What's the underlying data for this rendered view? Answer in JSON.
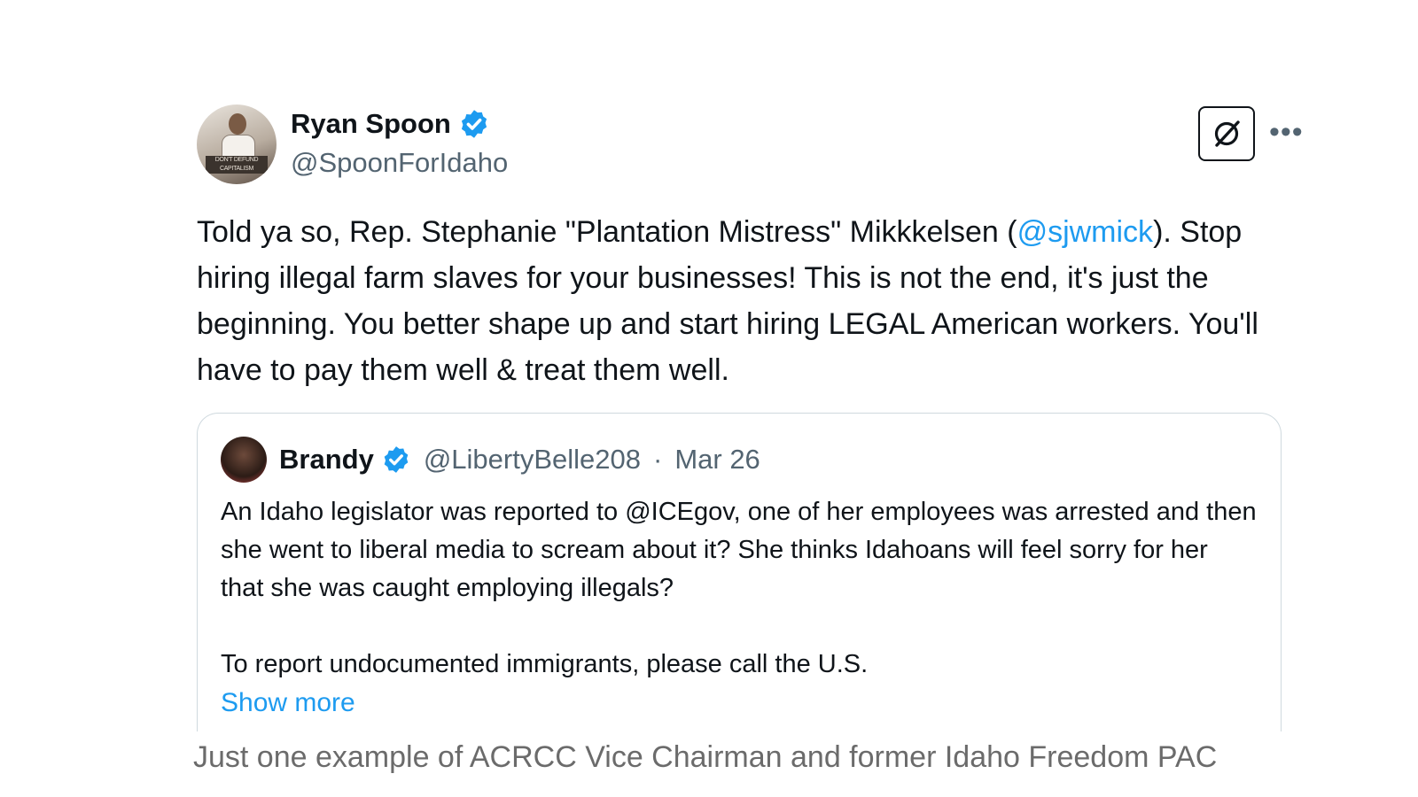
{
  "tweet": {
    "author_name": "Ryan Spoon",
    "author_handle": "@SpoonForIdaho",
    "avatar_caption": "DON'T DEFUND CAPITALISM",
    "more_label": "•••",
    "text_before": "Told ya so, Rep. Stephanie \"Plantation Mistress\" Mikkkelsen (",
    "mention": "@sjwmick",
    "text_after": "). Stop hiring illegal farm slaves for your businesses! This is not the end, it's just the beginning. You better shape up and start hiring LEGAL American workers. You'll have to pay them well & treat them well."
  },
  "quote": {
    "author_name": "Brandy",
    "author_handle": "@LibertyBelle208",
    "separator": "·",
    "date": "Mar 26",
    "paragraph1": "An Idaho legislator was reported to @ICEgov, one of her employees was arrested and then she went to liberal media to scream about it? She thinks Idahoans will feel sorry for her that she was caught employing illegals?",
    "paragraph2": "To report undocumented immigrants, please call the U.S.",
    "show_more": "Show more"
  },
  "caption": "Just one example of ACRCC Vice Chairman and former Idaho Freedom PAC",
  "colors": {
    "accent": "#1d9bf0",
    "text": "#0f1419",
    "secondary": "#536471",
    "border": "#cfd9de"
  },
  "icons": {
    "verified": "verified-badge-icon",
    "grok": "grok-icon",
    "more": "more-icon"
  }
}
